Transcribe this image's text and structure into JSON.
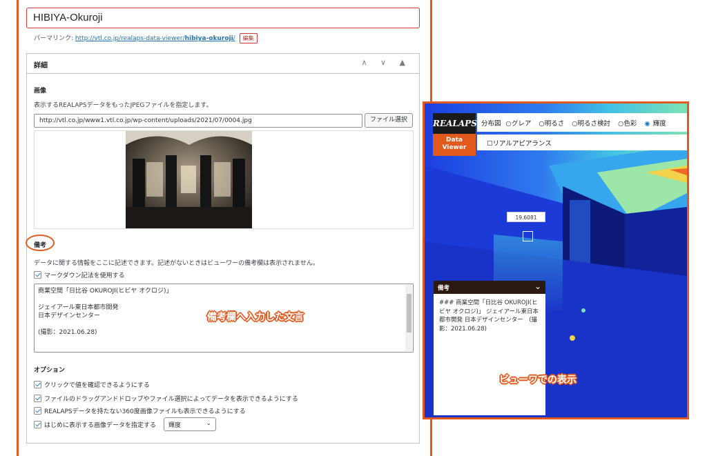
{
  "post": {
    "title": "HIBIYA-Okuroji",
    "permalink_label": "パーマリンク:",
    "permalink_base": "http://vtl.co.jp/realaps-data-viewer/",
    "permalink_slug": "hibiya-okuroji",
    "permalink_trail": "/",
    "edit_label": "編集"
  },
  "panel": {
    "title": "詳細",
    "controls": "∧ ∨ ▲"
  },
  "image_section": {
    "label": "画像",
    "description": "表示するREALAPSデータをもったJPEGファイルを指定します。",
    "url_value": "http://vtl.co.jp/www1.vtl.co.jp/wp-content/uploads/2021/07/0004.jpg",
    "file_button": "ファイル選択"
  },
  "notes_section": {
    "label": "備考",
    "description": "データに関する情報をここに記述できます。記述がないときはビューワーの備考欄は表示されません。",
    "markdown_checkbox": "マークダウン記法を使用する",
    "textarea_lines": [
      "商業空間「日比谷 OKUROJI(ヒビヤ オクロジ)」",
      "",
      "ジェイアール東日本都市開発",
      "日本デザインセンター",
      "",
      "(撮影：2021.06.28)"
    ]
  },
  "options_section": {
    "label": "オプション",
    "items": [
      "クリックで値を確認できるようにする",
      "ファイルのドラッグアンドドロップやファイル選択によってデータを表示できるようにする",
      "REALAPSデータを持たない360度画像ファイルも表示できるようにする",
      "はじめに表示する画像データを指定する"
    ],
    "select_value": "輝度"
  },
  "annotations": {
    "left": "備考欄へ入力した文言",
    "right": "ビューワでの表示"
  },
  "viewer": {
    "logo_top": "REALAPS",
    "logo_bottom_1": "Data",
    "logo_bottom_2": "Viewer",
    "radio_options": [
      "分布図",
      "グレア",
      "明るさ",
      "明るさ検討",
      "色彩",
      "輝度"
    ],
    "selected_radio": "輝度",
    "real_appearance": "リアルアピアランス",
    "value_readout": "19.6081",
    "notes_title": "備考",
    "notes_text": "### 商業空間「日比谷 OKUROJI(ヒビヤ オクロジ)」 ジェイアール東日本都市開発 日本デザインセンター　(撮影：2021.06.28)"
  },
  "colors": {
    "accent": "#e2591e",
    "error_border": "#d63638",
    "link": "#2271b1",
    "viewer_blue": "#1b39d8"
  }
}
